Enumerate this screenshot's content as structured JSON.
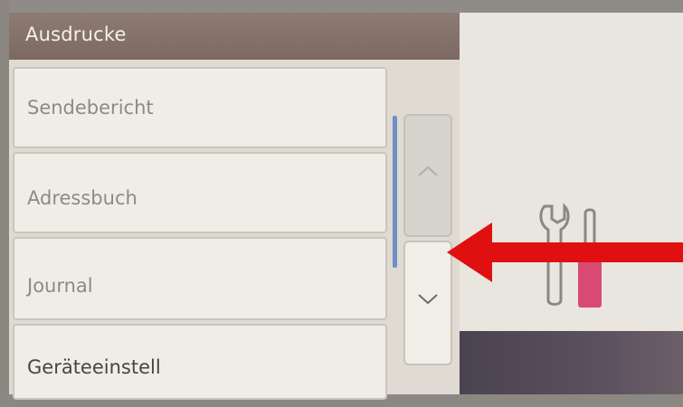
{
  "header": {
    "title": "Ausdrucke"
  },
  "menu": {
    "items": [
      {
        "label": "Sendebericht"
      },
      {
        "label": "Adressbuch"
      },
      {
        "label": "Journal"
      },
      {
        "label": "Geräteeinstell"
      }
    ]
  },
  "scroll": {
    "up_icon": "chevron-up-icon",
    "down_icon": "chevron-down-icon"
  },
  "side_panel": {
    "icon": "wrench-screwdriver-icon",
    "accent_color": "#d94a73"
  },
  "annotation": {
    "icon": "red-arrow-pointing-left",
    "color": "#e01010"
  }
}
